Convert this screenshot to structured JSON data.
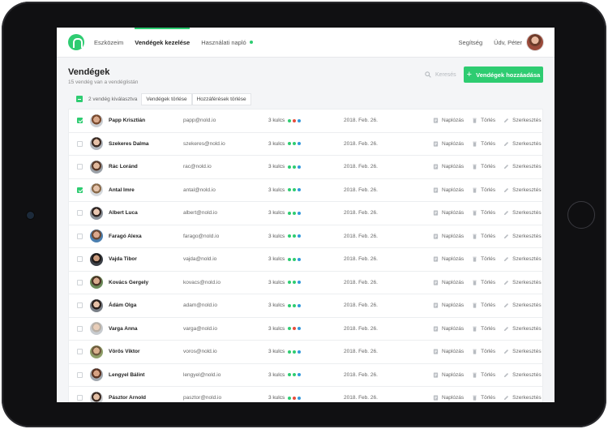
{
  "nav": {
    "items": [
      {
        "label": "Eszközeim",
        "active": false
      },
      {
        "label": "Vendégek kezelése",
        "active": true
      },
      {
        "label": "Használati napló",
        "active": false,
        "dot": true
      }
    ],
    "help": "Segítség",
    "greeting": "Üdv, Péter"
  },
  "page": {
    "title": "Vendégek",
    "subtitle": "15 vendég van a vendéglistán",
    "search_placeholder": "Keresés",
    "add_button": "Vendégek hozzáadása"
  },
  "bulk": {
    "selected_text": "2 vendég kiválasztva",
    "delete_guests": "Vendégek törlése",
    "delete_access": "Hozzáférések törlése"
  },
  "colors": {
    "accent": "#2ecc71",
    "dot_green": "#2ecc71",
    "dot_red": "#e74c3c",
    "dot_blue": "#3498db"
  },
  "actions": {
    "log": "Naplózás",
    "delete": "Törlés",
    "edit": "Szerkesztés"
  },
  "guests": [
    {
      "name": "Papp Krisztián",
      "email": "papp@nold.io",
      "keys": "3 kulcs",
      "dots": [
        "#2ecc71",
        "#e74c3c",
        "#3498db"
      ],
      "date": "2018. Feb. 26.",
      "checked": true
    },
    {
      "name": "Szekeres Dalma",
      "email": "szekeres@nold.io",
      "keys": "3 kulcs",
      "dots": [
        "#2ecc71",
        "#2ecc71",
        "#3498db"
      ],
      "date": "2018. Feb. 26.",
      "checked": false
    },
    {
      "name": "Rác Loránd",
      "email": "rac@nold.io",
      "keys": "3 kulcs",
      "dots": [
        "#2ecc71",
        "#2ecc71",
        "#3498db"
      ],
      "date": "2018. Feb. 26.",
      "checked": false
    },
    {
      "name": "Antal Imre",
      "email": "antal@nold.io",
      "keys": "3 kulcs",
      "dots": [
        "#2ecc71",
        "#2ecc71",
        "#3498db"
      ],
      "date": "2018. Feb. 26.",
      "checked": true
    },
    {
      "name": "Albert Luca",
      "email": "albert@nold.io",
      "keys": "3 kulcs",
      "dots": [
        "#2ecc71",
        "#2ecc71",
        "#3498db"
      ],
      "date": "2018. Feb. 26.",
      "checked": false
    },
    {
      "name": "Faragó Alexa",
      "email": "farago@nold.io",
      "keys": "3 kulcs",
      "dots": [
        "#2ecc71",
        "#2ecc71",
        "#3498db"
      ],
      "date": "2018. Feb. 26.",
      "checked": false
    },
    {
      "name": "Vajda Tibor",
      "email": "vajda@nold.io",
      "keys": "3 kulcs",
      "dots": [
        "#2ecc71",
        "#2ecc71",
        "#3498db"
      ],
      "date": "2018. Feb. 26.",
      "checked": false
    },
    {
      "name": "Kovács Gergely",
      "email": "kovacs@nold.io",
      "keys": "3 kulcs",
      "dots": [
        "#2ecc71",
        "#2ecc71",
        "#3498db"
      ],
      "date": "2018. Feb. 26.",
      "checked": false
    },
    {
      "name": "Ádám Olga",
      "email": "adam@nold.io",
      "keys": "3 kulcs",
      "dots": [
        "#2ecc71",
        "#2ecc71",
        "#3498db"
      ],
      "date": "2018. Feb. 26.",
      "checked": false
    },
    {
      "name": "Varga Anna",
      "email": "varga@nold.io",
      "keys": "3 kulcs",
      "dots": [
        "#2ecc71",
        "#e74c3c",
        "#3498db"
      ],
      "date": "2018. Feb. 26.",
      "checked": false
    },
    {
      "name": "Vörös Viktor",
      "email": "voros@nold.io",
      "keys": "3 kulcs",
      "dots": [
        "#2ecc71",
        "#2ecc71",
        "#3498db"
      ],
      "date": "2018. Feb. 26.",
      "checked": false
    },
    {
      "name": "Lengyel Bálint",
      "email": "lengyel@nold.io",
      "keys": "3 kulcs",
      "dots": [
        "#2ecc71",
        "#2ecc71",
        "#3498db"
      ],
      "date": "2018. Feb. 26.",
      "checked": false
    },
    {
      "name": "Pásztor Arnold",
      "email": "pasztor@nold.io",
      "keys": "3 kulcs",
      "dots": [
        "#2ecc71",
        "#e74c3c",
        "#3498db"
      ],
      "date": "2018. Feb. 26.",
      "checked": false
    }
  ]
}
